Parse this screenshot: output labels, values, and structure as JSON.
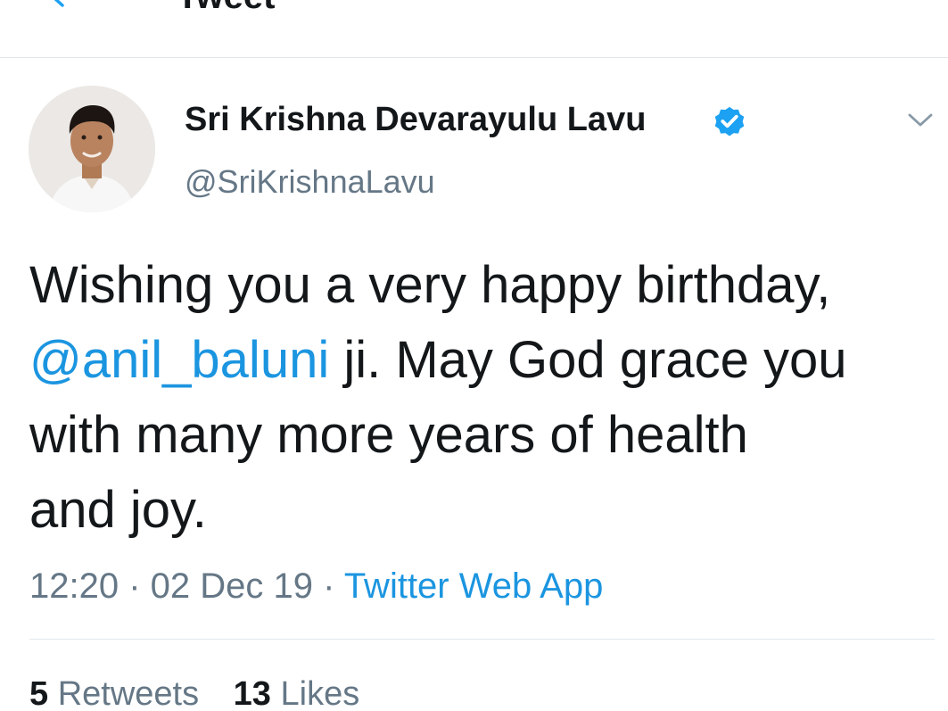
{
  "header": {
    "title": "Tweet",
    "back_icon": "back-arrow-icon"
  },
  "author": {
    "display_name": "Sri Krishna Devarayulu Lavu",
    "handle": "@SriKrishnaLavu",
    "verified_icon": "verified-badge-icon",
    "menu_icon": "chevron-down-icon"
  },
  "tweet": {
    "line1": "Wishing you a very happy birthday,",
    "mention": "@anil_baluni",
    "line2_rest": " ji. May God grace you",
    "line3": "with many more years of health",
    "line4": "and joy."
  },
  "meta": {
    "time": "12:20",
    "sep1": " · ",
    "date": "02 Dec 19",
    "sep2": " · ",
    "source": "Twitter Web App"
  },
  "stats": {
    "retweets_count": "5",
    "retweets_label": "Retweets",
    "likes_count": "13",
    "likes_label": "Likes"
  },
  "colors": {
    "accent": "#1b95e0",
    "text": "#14171a",
    "secondary": "#657786",
    "divider": "#e1e8ed"
  }
}
